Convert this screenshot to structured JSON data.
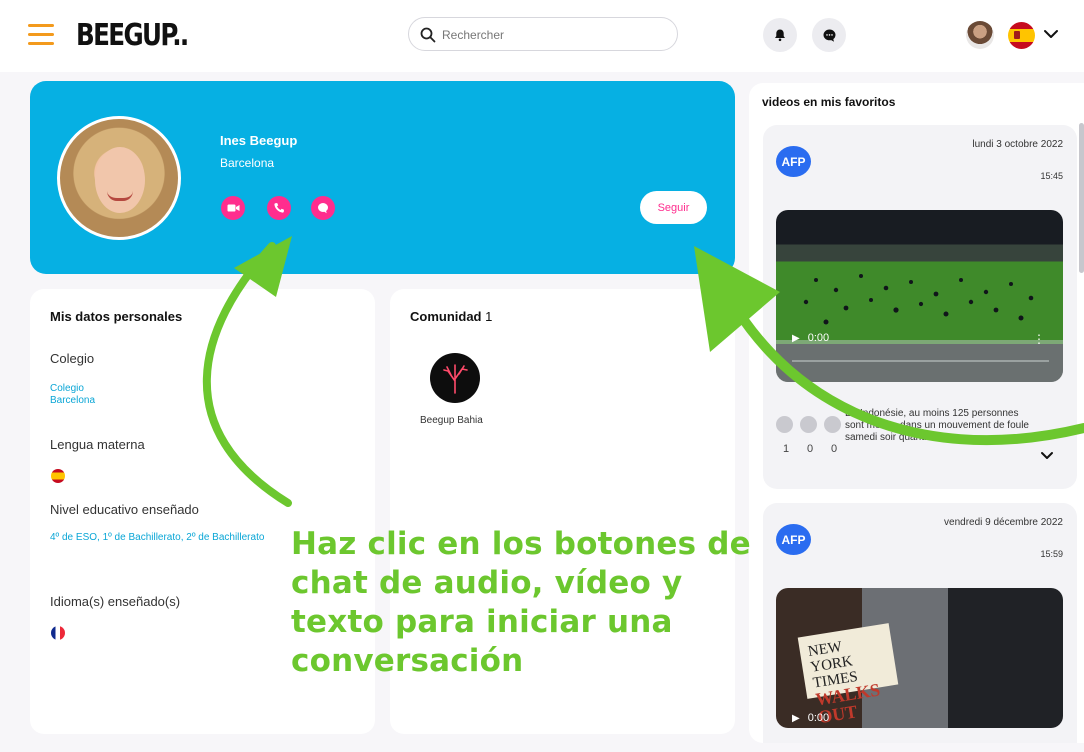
{
  "header": {
    "logo_text": "BEEGUP..",
    "search_placeholder": "Rechercher",
    "icons": [
      "hamburger-icon",
      "search-icon",
      "bell-icon",
      "chat-icon",
      "avatar",
      "flag-spain-icon",
      "chevron-down-icon"
    ]
  },
  "profile": {
    "name": "Ines Beegup",
    "city": "Barcelona",
    "follow_label": "Seguir",
    "actions": [
      "video-call-icon",
      "phone-icon",
      "chat-icon"
    ]
  },
  "personal": {
    "title": "Mis datos personales",
    "school_label": "Colegio",
    "school_name": "Colegio",
    "school_city": "Barcelona",
    "mother_tongue_label": "Lengua materna",
    "level_label": "Nivel educativo enseñado",
    "levels": "4º de ESO, 1º de Bachillerato, 2º de Bachillerato",
    "languages_label": "Idioma(s) enseñado(s)"
  },
  "community": {
    "title": "Comunidad",
    "count": "1",
    "member_name": "Beegup Bahia"
  },
  "favorites": {
    "title": "videos en mis favoritos",
    "videos": [
      {
        "source": "AFP",
        "date": "lundi 3 octobre 2022",
        "time": "15:45",
        "player_time": "0:00",
        "description": "En Indonésie, au moins 125 personnes sont mortes dans un mouvement de foule samedi soir quand des",
        "likes": "1",
        "shares": "0",
        "comments": "0"
      },
      {
        "source": "AFP",
        "date": "vendredi 9 décembre 2022",
        "time": "15:59",
        "player_time": "0:00",
        "sign_line1": "NEW",
        "sign_line2": "YORK TIMES",
        "sign_line3": "WALKS OUT"
      }
    ]
  },
  "annotation": {
    "text": "Haz clic en los botones de chat de audio, vídeo y texto para iniciar una conversación",
    "color": "#6cc72e"
  },
  "colors": {
    "accent": "#06b0e3",
    "action_pink": "#ff2d8e",
    "menu_orange": "#f39a1c"
  }
}
